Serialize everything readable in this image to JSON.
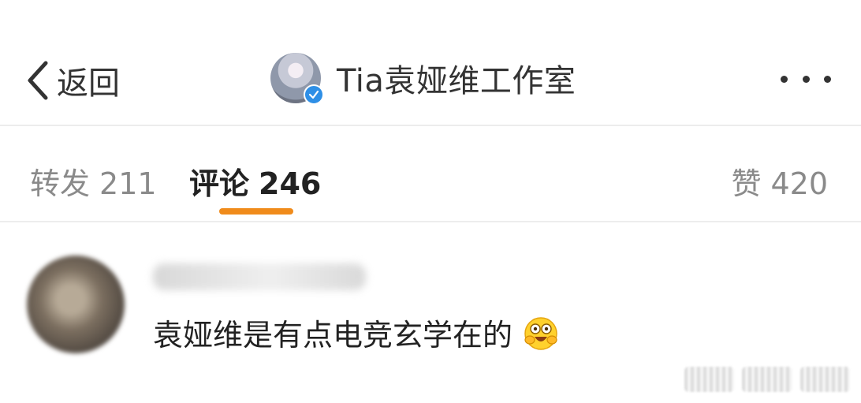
{
  "header": {
    "back_label": "返回",
    "profile_name": "Tia袁娅维工作室"
  },
  "tabs": [
    {
      "label": "转发",
      "count": "211",
      "active": false
    },
    {
      "label": "评论",
      "count": "246",
      "active": true
    },
    {
      "label": "赞",
      "count": "420",
      "active": false
    }
  ],
  "comment": {
    "text": "袁娅维是有点电竞玄学在的",
    "emoji": "hugging-face-emoji"
  },
  "colors": {
    "accent": "#f08b1b",
    "verified": "#2e8fe6",
    "text_primary": "#222222",
    "text_secondary": "#8a8a8a"
  },
  "icons": {
    "back": "chevron-left-icon",
    "more": "more-dots-icon",
    "verified": "verified-badge-icon"
  }
}
